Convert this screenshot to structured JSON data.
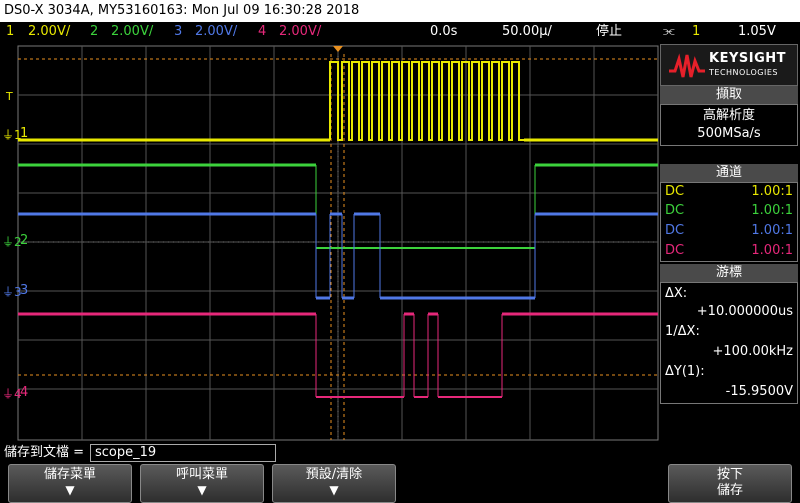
{
  "title_bar": {
    "text": "DS0-X 3034A, MY53160163: Mon Jul 09 16:30:28 2018"
  },
  "status": {
    "ch1": {
      "num": "1",
      "scale": "2.00V/",
      "color": "#e8e800"
    },
    "ch2": {
      "num": "2",
      "scale": "2.00V/",
      "color": "#3cd23c"
    },
    "ch3": {
      "num": "3",
      "scale": "2.00V/",
      "color": "#5078e6"
    },
    "ch4": {
      "num": "4",
      "scale": "2.00V/",
      "color": "#e6287a"
    },
    "delay": "0.0s",
    "timebase": "50.00µ/",
    "run_state": "停止",
    "trigger_icon": "⫘",
    "trigger_channel": "1",
    "trigger_level": "1.05V"
  },
  "waveform_markers": {
    "t": "T",
    "ch1": "1",
    "ch2": "2",
    "ch3": "3",
    "ch4": "4"
  },
  "right_panel": {
    "logo": {
      "brand": "KEYSIGHT",
      "sub": "TECHNOLOGIES"
    },
    "acquire": {
      "header": "擷取",
      "mode": "高解析度",
      "rate": "500MSa/s"
    },
    "channels": {
      "header": "通道",
      "rows": [
        {
          "coupling": "DC",
          "probe": "1.00:1",
          "color": "#e8e800"
        },
        {
          "coupling": "DC",
          "probe": "1.00:1",
          "color": "#3cd23c"
        },
        {
          "coupling": "DC",
          "probe": "1.00:1",
          "color": "#5078e6"
        },
        {
          "coupling": "DC",
          "probe": "1.00:1",
          "color": "#e6287a"
        }
      ]
    },
    "cursors": {
      "header": "游標",
      "dx_label": "ΔX:",
      "dx_value": "+10.000000us",
      "inv_dx_label": "1/ΔX:",
      "inv_dx_value": "+100.00kHz",
      "dy_label": "ΔY(1):",
      "dy_value": "-15.9500V"
    }
  },
  "bottom": {
    "save_label": "儲存到文檔 =",
    "filename": "scope_19",
    "softkeys": [
      {
        "label": "儲存菜單",
        "arrow": "▼"
      },
      {
        "label": "呼叫菜單",
        "arrow": "▼"
      },
      {
        "label": "預設/清除",
        "arrow": "▼"
      },
      {
        "label": "按下",
        "label2": "儲存"
      }
    ]
  }
}
